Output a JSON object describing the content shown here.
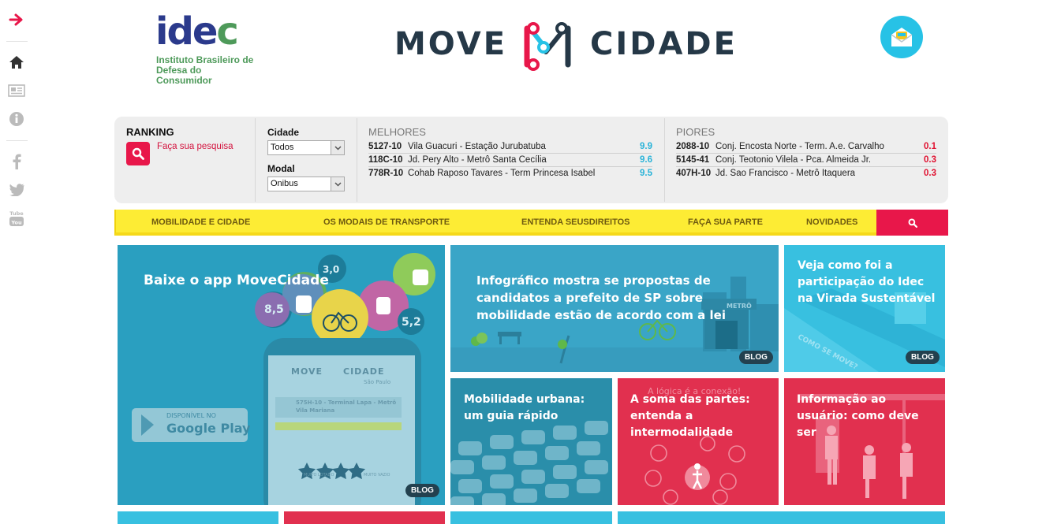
{
  "sidebar": {
    "items": [
      {
        "icon": "arrow-right-icon",
        "color": "#e8174a"
      },
      {
        "icon": "home-icon",
        "color": "#333333"
      },
      {
        "icon": "newspaper-icon",
        "color": "#bbbbbb"
      },
      {
        "icon": "info-icon",
        "color": "#bbbbbb"
      },
      {
        "icon": "facebook-icon",
        "color": "#bbbbbb"
      },
      {
        "icon": "twitter-icon",
        "color": "#bbbbbb"
      },
      {
        "icon": "youtube-icon",
        "color": "#bbbbbb"
      }
    ]
  },
  "header": {
    "idec_logo": {
      "word": "ide",
      "letter_c": "c",
      "line1": "Instituto Brasileiro de",
      "line2": "Defesa do Consumidor"
    },
    "brand": {
      "left": "MOVE",
      "right": "CIDADE"
    },
    "newsletter_icon": "mail-bus-icon"
  },
  "ranking": {
    "title": "RANKING",
    "search_link": "Faça sua pesquisa",
    "city_label": "Cidade",
    "city_value": "Todos",
    "mode_label": "Modal",
    "mode_value": "Onibus",
    "best": {
      "heading": "MELHORES",
      "rows": [
        {
          "code": "5127-10",
          "name": "Vila Guacuri - Estação Jurubatuba",
          "score": "9.9"
        },
        {
          "code": "118C-10",
          "name": "Jd. Pery Alto - Metrô Santa Cecília",
          "score": "9.6"
        },
        {
          "code": "778R-10",
          "name": "Cohab Raposo Tavares - Term Princesa Isabel",
          "score": "9.5"
        }
      ]
    },
    "worst": {
      "heading": "PIORES",
      "rows": [
        {
          "code": "2088-10",
          "name": "Conj. Encosta Norte - Term. A.e. Carvalho",
          "score": "0.1"
        },
        {
          "code": "5145-41",
          "name": "Conj. Teotonio Vilela - Pca. Almeida Jr.",
          "score": "0.3"
        },
        {
          "code": "407H-10",
          "name": "Jd. Sao Francisco - Metrô Itaquera",
          "score": "0.3"
        }
      ]
    },
    "colors": {
      "best_score": "#29b3d8",
      "worst_score": "#e0102f"
    }
  },
  "nav": {
    "items": [
      "MOBILIDADE E CIDADE",
      "OS MODAIS DE TRANSPORTE",
      "ENTENDA SEUSDIREITOS",
      "FAÇA SUA PARTE",
      "NOVIDADES"
    ]
  },
  "tiles": [
    {
      "title": "Baixe o app MoveCidade",
      "badge": "BLOG",
      "bubbles": [
        "3,0",
        "8,5",
        "5,2"
      ],
      "phone_brand": "MOVE",
      "phone_brand2": "CIDADE",
      "phone_city": "São Paulo",
      "phone_line1": "575H-10 - Terminal Lapa - Metrô",
      "phone_line2": "Vila Mariana",
      "store_top": "DISPONÍVEL NO",
      "store_name": "Google Play",
      "rating_left": "MUITO LOTADO",
      "rating_right": "MUITO VAZIO"
    },
    {
      "title": "Infográfico mostra se propostas de candidatos a prefeito de SP sobre mobilidade estão de acordo com a lei",
      "badge": "BLOG",
      "sign": "METRÔ"
    },
    {
      "title": "Veja como foi a participação do Idec na Virada Sustentável",
      "badge": "BLOG",
      "street_text": "COMO SE MOVE?"
    },
    {
      "title": "Mobilidade urbana: um guia rápido"
    },
    {
      "title": "A soma das partes: entenda a intermodalidade",
      "bg_text": "A lógica é a conexão!"
    },
    {
      "title": "Informação ao usuário: como deve ser"
    }
  ],
  "colors": {
    "accent": "#e8174a",
    "nav_yellow": "#fdec34",
    "tile_blue": "#2a9fc0",
    "tile_red": "#e1304f",
    "tile_cyan": "#38c0e0"
  }
}
